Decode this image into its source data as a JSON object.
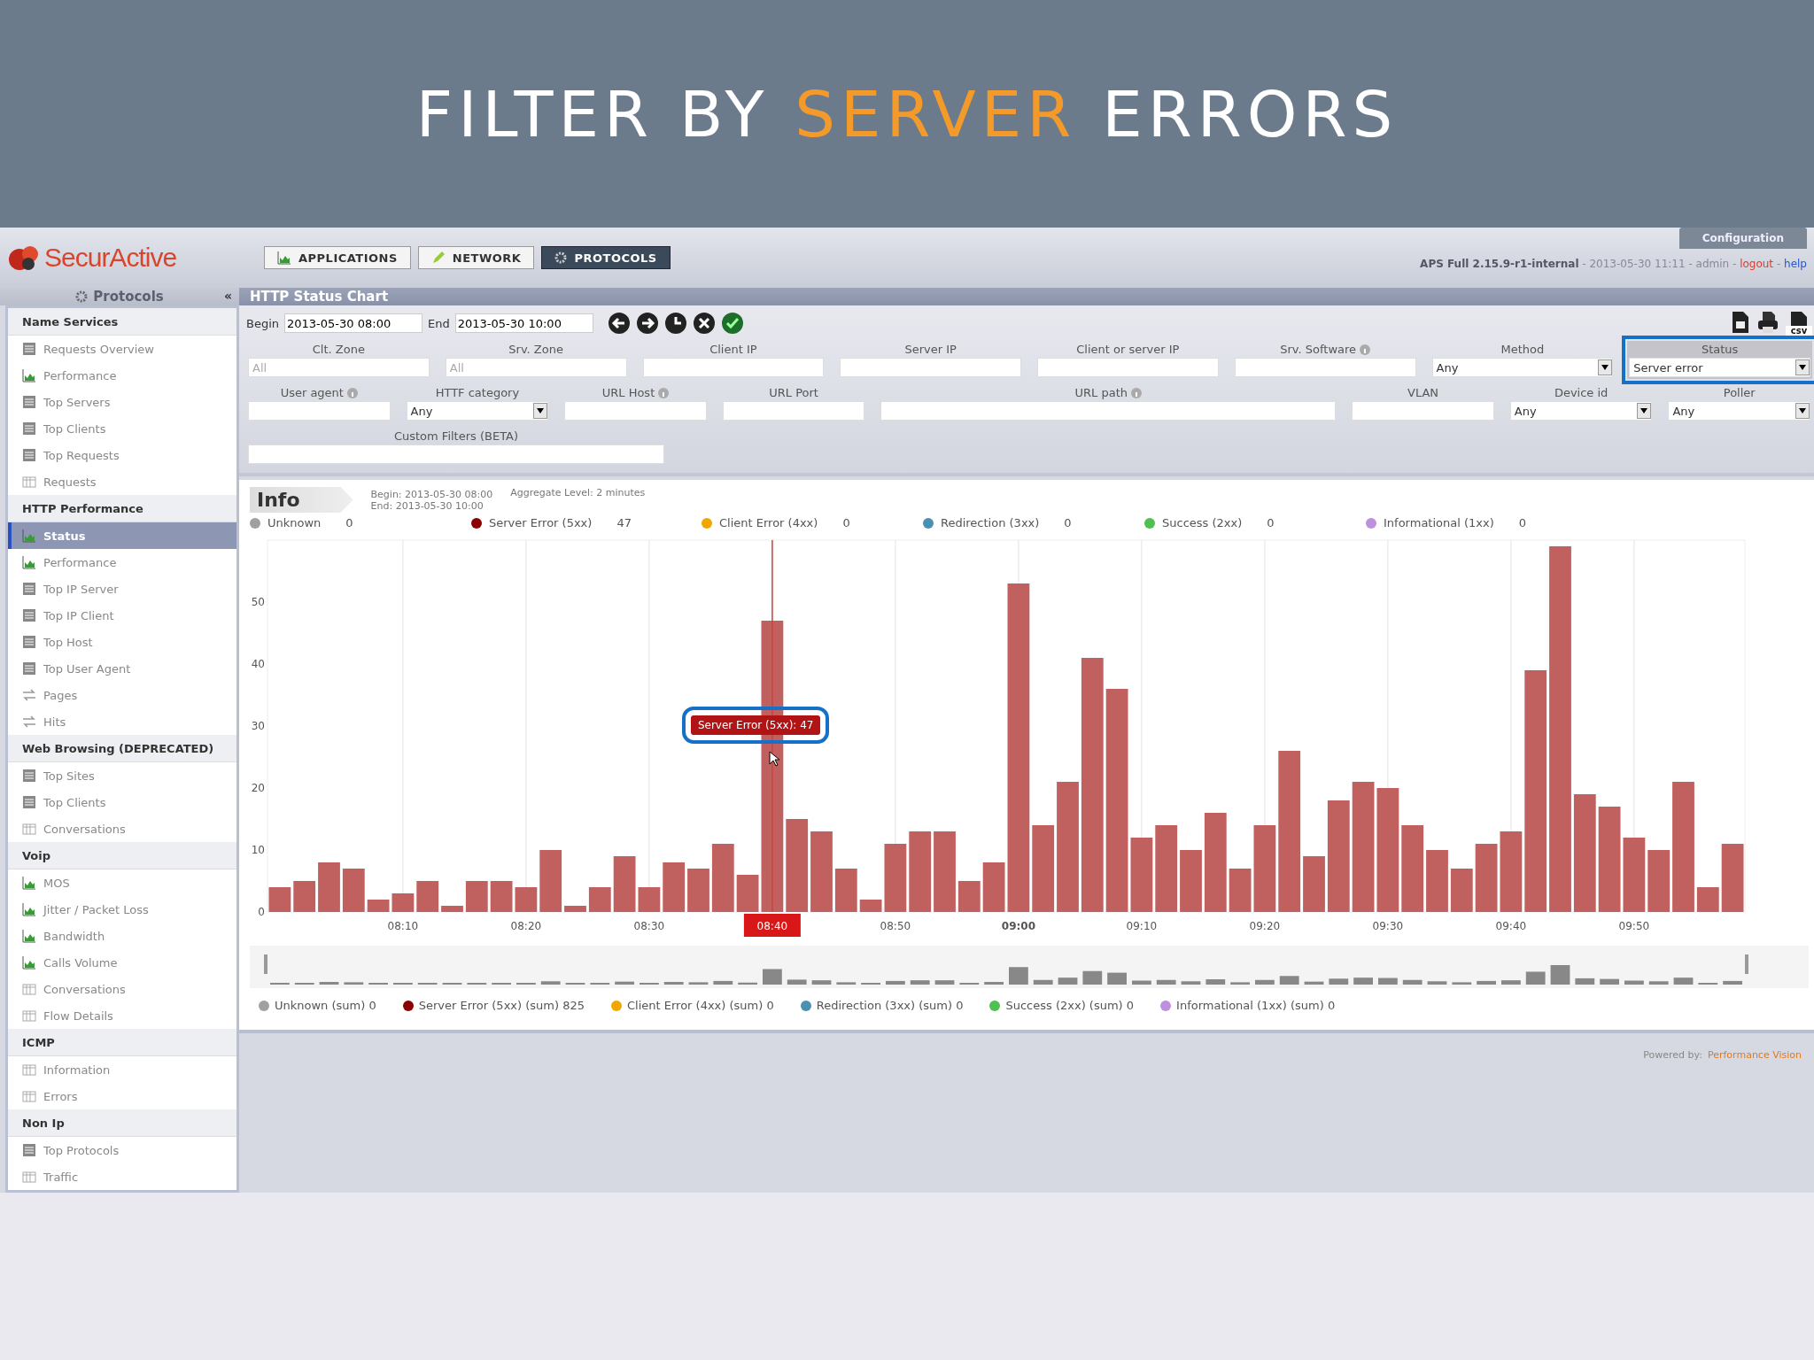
{
  "slide_title": [
    {
      "text": "FILTER BY ",
      "accent": false
    },
    {
      "text": "SERVER",
      "accent": true
    },
    {
      "text": " ERRORS",
      "accent": false
    }
  ],
  "app": {
    "logo": "SecurActive",
    "tabs": [
      {
        "label": "APPLICATIONS",
        "kind": "chart",
        "selected": false
      },
      {
        "label": "NETWORK",
        "kind": "pencil",
        "selected": false
      },
      {
        "label": "PROTOCOLS",
        "kind": "gear",
        "selected": true
      }
    ],
    "config_button": "Configuration",
    "status_line": [
      {
        "text": "APS Full 2.15.9-r1-internal",
        "kind": "bold"
      },
      {
        "text": " - 2013-05-30 11:11 - admin - ",
        "kind": "plain"
      },
      {
        "text": "logout",
        "kind": "danger"
      },
      {
        "text": " - ",
        "kind": "plain"
      },
      {
        "text": "help",
        "kind": "link"
      }
    ]
  },
  "sidebar": {
    "title": "Protocols",
    "collapse": "«",
    "groups": [
      {
        "title": "Name Services",
        "items": [
          {
            "label": "Requests Overview",
            "kind": "list",
            "selected": false
          },
          {
            "label": "Performance",
            "kind": "chart",
            "selected": false
          },
          {
            "label": "Top Servers",
            "kind": "list",
            "selected": false
          },
          {
            "label": "Top Clients",
            "kind": "list",
            "selected": false
          },
          {
            "label": "Top Requests",
            "kind": "list",
            "selected": false
          },
          {
            "label": "Requests",
            "kind": "table",
            "selected": false
          }
        ]
      },
      {
        "title": "HTTP Performance",
        "items": [
          {
            "label": "Status",
            "kind": "chart",
            "selected": true
          },
          {
            "label": "Performance",
            "kind": "chart",
            "selected": false
          },
          {
            "label": "Top IP Server",
            "kind": "list",
            "selected": false
          },
          {
            "label": "Top IP Client",
            "kind": "list",
            "selected": false
          },
          {
            "label": "Top Host",
            "kind": "list",
            "selected": false
          },
          {
            "label": "Top User Agent",
            "kind": "list",
            "selected": false
          },
          {
            "label": "Pages",
            "kind": "swap",
            "selected": false
          },
          {
            "label": "Hits",
            "kind": "swap",
            "selected": false
          }
        ]
      },
      {
        "title": "Web Browsing (DEPRECATED)",
        "items": [
          {
            "label": "Top Sites",
            "kind": "list",
            "selected": false
          },
          {
            "label": "Top Clients",
            "kind": "list",
            "selected": false
          },
          {
            "label": "Conversations",
            "kind": "table",
            "selected": false
          }
        ]
      },
      {
        "title": "Voip",
        "items": [
          {
            "label": "MOS",
            "kind": "chart",
            "selected": false
          },
          {
            "label": "Jitter / Packet Loss",
            "kind": "chart",
            "selected": false
          },
          {
            "label": "Bandwidth",
            "kind": "chart",
            "selected": false
          },
          {
            "label": "Calls Volume",
            "kind": "chart",
            "selected": false
          },
          {
            "label": "Conversations",
            "kind": "table",
            "selected": false
          },
          {
            "label": "Flow Details",
            "kind": "table",
            "selected": false
          }
        ]
      },
      {
        "title": "ICMP",
        "items": [
          {
            "label": "Information",
            "kind": "table",
            "selected": false
          },
          {
            "label": "Errors",
            "kind": "table",
            "selected": false
          }
        ]
      },
      {
        "title": "Non Ip",
        "items": [
          {
            "label": "Top Protocols",
            "kind": "list",
            "selected": false
          },
          {
            "label": "Traffic",
            "kind": "table",
            "selected": false
          }
        ]
      }
    ]
  },
  "panel_title": "HTTP Status Chart",
  "range": {
    "begin_label": "Begin",
    "begin": "2013-05-30 08:00",
    "end_label": "End",
    "end": "2013-05-30 10:00"
  },
  "toolbar": [
    {
      "kind": "left"
    },
    {
      "kind": "right"
    },
    {
      "kind": "clock"
    },
    {
      "kind": "clear"
    },
    {
      "kind": "apply"
    }
  ],
  "exports": [
    {
      "kind": "pdf"
    },
    {
      "kind": "print"
    },
    {
      "kind": "csv",
      "label": "csv"
    }
  ],
  "filter_rows": [
    [
      {
        "label": "Clt. Zone",
        "kind": "combo",
        "placeholder": "All",
        "info": false,
        "highlighted": false
      },
      {
        "label": "Srv. Zone",
        "kind": "combo",
        "placeholder": "All",
        "info": false,
        "highlighted": false
      },
      {
        "label": "Client IP",
        "kind": "text",
        "info": false,
        "highlighted": false
      },
      {
        "label": "Server IP",
        "kind": "text",
        "info": false,
        "highlighted": false
      },
      {
        "label": "Client or server IP",
        "kind": "text",
        "info": false,
        "highlighted": false
      },
      {
        "label": "Srv. Software",
        "kind": "text",
        "info": true,
        "highlighted": false
      },
      {
        "label": "Method",
        "kind": "select",
        "value": "Any",
        "info": false,
        "highlighted": false
      },
      {
        "label": "Status",
        "kind": "select",
        "value": "Server error",
        "info": false,
        "highlighted": true
      }
    ],
    [
      {
        "label": "User agent",
        "kind": "text",
        "info": true,
        "highlighted": false
      },
      {
        "label": "HTTF category",
        "kind": "select",
        "value": "Any",
        "info": false,
        "highlighted": false
      },
      {
        "label": "URL Host",
        "kind": "text",
        "info": true,
        "highlighted": false
      },
      {
        "label": "URL Port",
        "kind": "text",
        "info": false,
        "highlighted": false
      },
      {
        "label": "URL path",
        "kind": "wide",
        "info": true,
        "highlighted": false
      },
      {
        "label": "VLAN",
        "kind": "text",
        "info": false,
        "highlighted": false
      },
      {
        "label": "Device id",
        "kind": "select",
        "value": "Any",
        "info": false,
        "highlighted": false
      },
      {
        "label": "Poller",
        "kind": "select",
        "value": "Any",
        "info": false,
        "highlighted": false
      }
    ],
    [
      {
        "label": "Custom Filters (BETA)",
        "kind": "custom",
        "info": false,
        "highlighted": false
      }
    ]
  ],
  "info": {
    "tab": "Info",
    "begin": "Begin: 2013-05-30 08:00",
    "end": "End: 2013-05-30 10:00",
    "aggregate": "Aggregate Level: 2 minutes"
  },
  "legend": [
    {
      "name": "Unknown",
      "value": "0",
      "color": "#a0a0a0"
    },
    {
      "name": "Server Error (5xx)",
      "value": "47",
      "color": "#8b0000"
    },
    {
      "name": "Client Error (4xx)",
      "value": "0",
      "color": "#f0a800"
    },
    {
      "name": "Redirection (3xx)",
      "value": "0",
      "color": "#4a90b0"
    },
    {
      "name": "Success (2xx)",
      "value": "0",
      "color": "#50c050"
    },
    {
      "name": "Informational (1xx)",
      "value": "0",
      "color": "#c090e0"
    }
  ],
  "chart_data": {
    "type": "bar",
    "categories": [
      null,
      null,
      null,
      null,
      null,
      "08:10",
      null,
      null,
      null,
      null,
      "08:20",
      null,
      null,
      null,
      null,
      "08:30",
      null,
      null,
      null,
      null,
      "08:40",
      null,
      null,
      null,
      null,
      "08:50",
      null,
      null,
      null,
      null,
      "09:00",
      null,
      null,
      null,
      null,
      "09:10",
      null,
      null,
      null,
      null,
      "09:20",
      null,
      null,
      null,
      null,
      "09:30",
      null,
      null,
      null,
      null,
      "09:40",
      null,
      null,
      null,
      null,
      "09:50",
      null,
      null,
      null,
      null
    ],
    "series": [
      {
        "color": "#c0605f",
        "values": [
          4,
          5,
          8,
          7,
          2,
          3,
          5,
          1,
          5,
          5,
          4,
          10,
          1,
          4,
          9,
          4,
          8,
          7,
          11,
          6,
          47,
          15,
          13,
          7,
          2,
          11,
          13,
          13,
          5,
          8,
          53,
          14,
          21,
          41,
          36,
          12,
          14,
          10,
          16,
          7,
          14,
          26,
          9,
          18,
          21,
          20,
          14,
          10,
          7,
          11,
          13,
          39,
          59,
          19,
          17,
          12,
          10,
          21,
          4,
          11
        ]
      }
    ],
    "ylim": [
      0,
      60
    ],
    "yticks": [
      0,
      10,
      20,
      30,
      40,
      50
    ],
    "grid": true,
    "ref_lines": [
      {
        "axis": "x",
        "value": "08:40",
        "color": "#d04040"
      }
    ],
    "annotations": [
      "Server Error (5xx): 47"
    ]
  },
  "sum_legend": [
    {
      "name": "Unknown (sum) 0",
      "color": "#a0a0a0"
    },
    {
      "name": "Server Error (5xx) (sum) 825",
      "color": "#8b0000"
    },
    {
      "name": "Client Error (4xx) (sum) 0",
      "color": "#f0a800"
    },
    {
      "name": "Redirection (3xx) (sum) 0",
      "color": "#4a90b0"
    },
    {
      "name": "Success (2xx) (sum) 0",
      "color": "#50c050"
    },
    {
      "name": "Informational (1xx) (sum) 0",
      "color": "#c090e0"
    }
  ],
  "footer": {
    "label": "Powered by:",
    "link": "Performance Vision"
  }
}
